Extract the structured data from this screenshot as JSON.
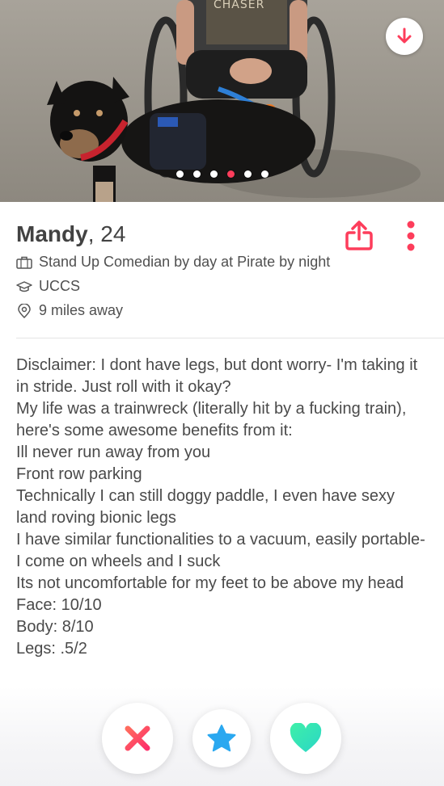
{
  "photo": {
    "shirt_text": "CHASER",
    "total_photos": 6,
    "active_photo_index": 3
  },
  "profile": {
    "name": "Mandy",
    "age": "24",
    "job": "Stand Up Comedian by day at Pirate by night",
    "school": "UCCS",
    "distance": "9 miles away"
  },
  "bio": {
    "text": "Disclaimer: I dont have legs, but dont worry- I'm taking it in stride. Just roll with it okay?\nMy life was a trainwreck (literally hit by a fucking train), here's some awesome benefits from it:\nIll never run away from you\nFront row parking\nTechnically I can still doggy paddle, I even have sexy land roving bionic legs\nI have similar functionalities to a vacuum, easily portable- I come on wheels and I suck\nIts not uncomfortable for my feet to be above my head\nFace: 10/10\nBody: 8/10\nLegs: .5/2"
  },
  "icons": {
    "collapse": "arrow-down-icon",
    "share": "share-icon",
    "more": "more-vertical-icon",
    "job": "briefcase-icon",
    "school": "graduation-cap-icon",
    "distance": "location-pin-icon",
    "nope": "close-x-icon",
    "super_like": "star-icon",
    "like": "heart-icon"
  },
  "colors": {
    "brand_red": "#fd3d5b",
    "super_like_blue": "#2aa8f0",
    "like_green": "#3ce3b5",
    "text": "#4a4a4a"
  }
}
